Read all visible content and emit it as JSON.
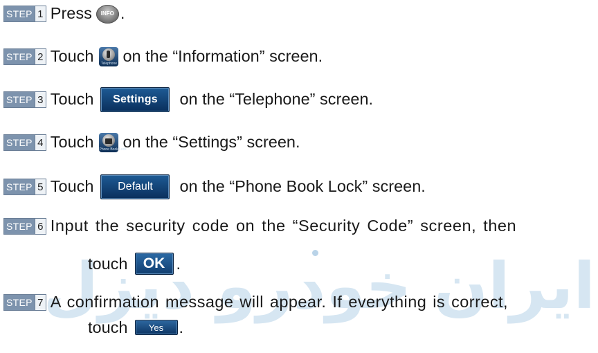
{
  "watermark": "ایران خودرو دیزل",
  "steps": [
    {
      "word": "STEP",
      "num": "1",
      "pre": "Press",
      "icon_label": "INFO",
      "post": "."
    },
    {
      "word": "STEP",
      "num": "2",
      "pre": "Touch",
      "icon_label": "Telephone",
      "post": "on the “Information” screen."
    },
    {
      "word": "STEP",
      "num": "3",
      "pre": "Touch",
      "button": "Settings",
      "post": "on the “Telephone” screen."
    },
    {
      "word": "STEP",
      "num": "4",
      "pre": "Touch",
      "icon_label": "Phone Book Lock",
      "post": "on the “Settings” screen."
    },
    {
      "word": "STEP",
      "num": "5",
      "pre": "Touch",
      "button": "Default",
      "post": "on the “Phone Book Lock” screen."
    },
    {
      "word": "STEP",
      "num": "6",
      "line1": "Input the security code on the “Security Code” screen, then",
      "pre2": "touch",
      "button": "OK",
      "post2": "."
    },
    {
      "word": "STEP",
      "num": "7",
      "line1": "A confirmation message will appear. If everything is correct,",
      "pre2": "touch",
      "button": "Yes",
      "post2": "."
    }
  ]
}
